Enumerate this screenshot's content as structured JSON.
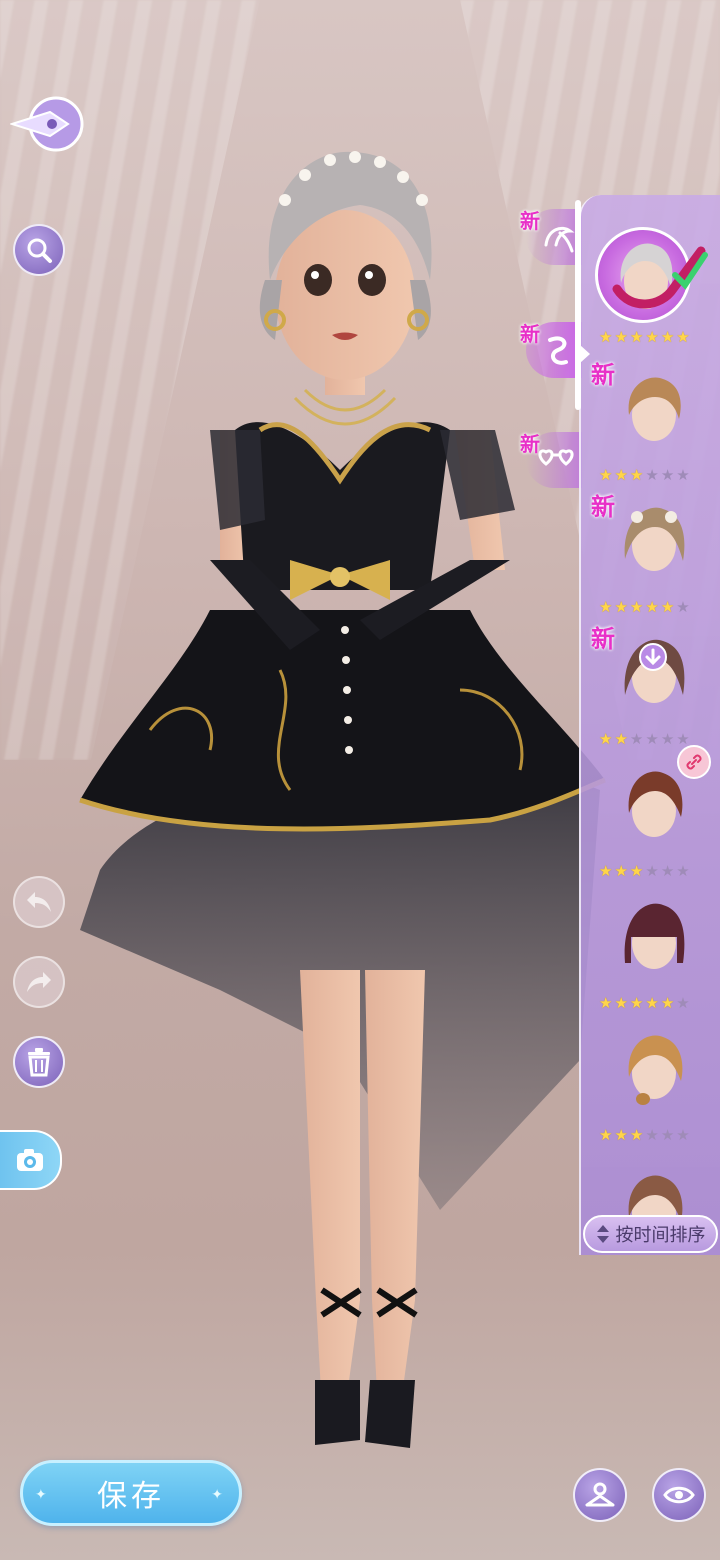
{
  "right_panel": {
    "category_tabs": [
      {
        "new_label": "新",
        "icon": "hair-sweep-icon",
        "active": false
      },
      {
        "new_label": "新",
        "icon": "hair-curl-icon",
        "active": true
      },
      {
        "new_label": "新",
        "icon": "heart-glasses-icon",
        "active": false
      }
    ],
    "items": [
      {
        "name": "silver-short-hair",
        "new_label": "",
        "stars": 6,
        "max_stars": 6,
        "selected": true
      },
      {
        "name": "brown-bun-hair",
        "new_label": "新",
        "stars": 3,
        "max_stars": 6
      },
      {
        "name": "flower-pigtail-hair",
        "new_label": "新",
        "stars": 5,
        "max_stars": 6
      },
      {
        "name": "wavy-download-hair",
        "new_label": "新",
        "stars": 2,
        "max_stars": 6,
        "download": true
      },
      {
        "name": "auburn-updo-hair",
        "new_label": "",
        "stars": 3,
        "max_stars": 6,
        "linked": true
      },
      {
        "name": "bob-bangs-hair",
        "new_label": "",
        "stars": 5,
        "max_stars": 6
      },
      {
        "name": "blonde-braid-hair",
        "new_label": "",
        "stars": 3,
        "max_stars": 6
      },
      {
        "name": "partial-hair",
        "new_label": "",
        "stars": 0,
        "max_stars": 6
      }
    ],
    "sort_label": "按时间排序"
  },
  "bottom": {
    "save_label": "保存"
  },
  "colors": {
    "accent_purple": "#b79ae0",
    "new_pink": "#e830c8",
    "save_blue": "#5bbbee",
    "star_gold": "#ffd54a"
  }
}
